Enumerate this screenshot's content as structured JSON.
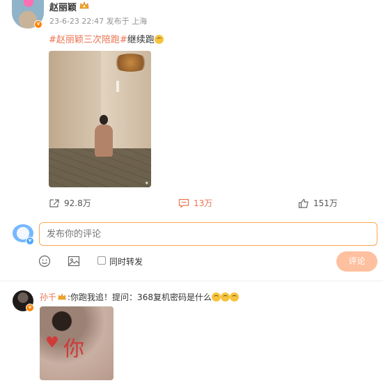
{
  "post": {
    "author_name": "赵丽颖",
    "timestamp": "23-6-23 22:47",
    "publish_location": "发布于 上海",
    "hashtag": "#赵丽颖三次陪跑#",
    "text": "继续跑"
  },
  "actions": {
    "share_count": "92.8万",
    "comment_count": "13万",
    "like_count": "151万"
  },
  "composer": {
    "placeholder": "发布你的评论",
    "forward_label": "同时转发",
    "submit_label": "评论"
  },
  "comment": {
    "user_name": "孙千",
    "text": ":你跑我追！提问：368复机密码是什么"
  },
  "icons": {
    "share": "share-icon",
    "comment": "comment-icon",
    "like": "like-icon",
    "emoji": "emoji-icon",
    "image": "image-icon",
    "verified": "verified-icon",
    "crown": "crown-icon"
  },
  "colors": {
    "accent": "#eb7350",
    "input_border": "#ffa54f",
    "submit_bg": "#ffc09f",
    "verified": "#ff8200"
  }
}
